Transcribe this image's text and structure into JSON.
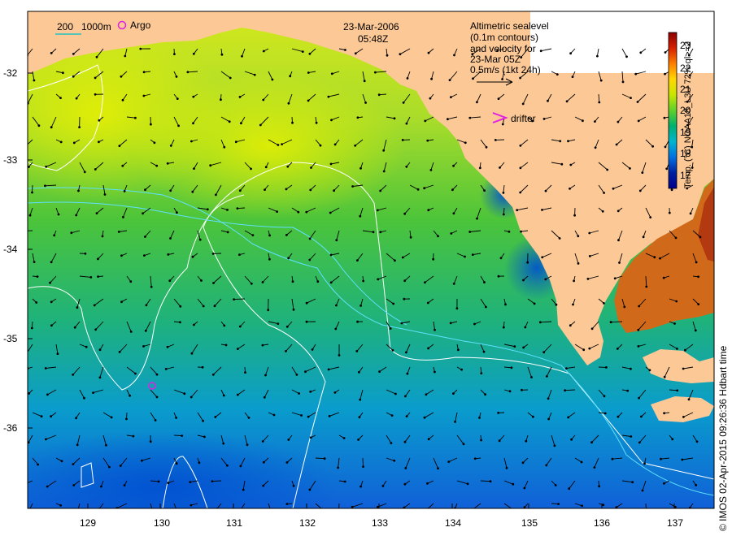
{
  "title": {
    "date": "23-Mar-2006",
    "time": "05:48Z"
  },
  "scale_legend": {
    "label_200": "200",
    "label_1000": "1000m",
    "argo_label": "Argo"
  },
  "info": {
    "line1": "Altimetric sealevel",
    "line2": "(0.1m contours)",
    "line3": "and velocity for",
    "line4": "23-Mar 05Z",
    "line5": "0.5m/s (1kt 24h)"
  },
  "drifter_label": "drifter",
  "colorbar": {
    "label": "Temp. (°C) NOAA18_L3U 72% ql>=2",
    "ticks": [
      "23",
      "22",
      "21",
      "20",
      "19",
      "18",
      "17"
    ],
    "colors": [
      "#8b0000",
      "#d62000",
      "#ff7f00",
      "#ffd700",
      "#c8e600",
      "#5fd02a",
      "#00b070",
      "#00b4d0",
      "#0070e0",
      "#0020a0",
      "#00008b"
    ]
  },
  "axes": {
    "lat_labels": [
      "-32",
      "-33",
      "-34",
      "-35",
      "-36"
    ],
    "lon_labels": [
      "129",
      "130",
      "131",
      "132",
      "133",
      "134",
      "135",
      "136",
      "137"
    ]
  },
  "credit": "© IMOS 02-Apr-2015 09:26:36 Hdbart time",
  "colors": {
    "land": "#fcc896",
    "ocean_warm": "#c8e600",
    "ocean_cool": "#0090d8"
  }
}
